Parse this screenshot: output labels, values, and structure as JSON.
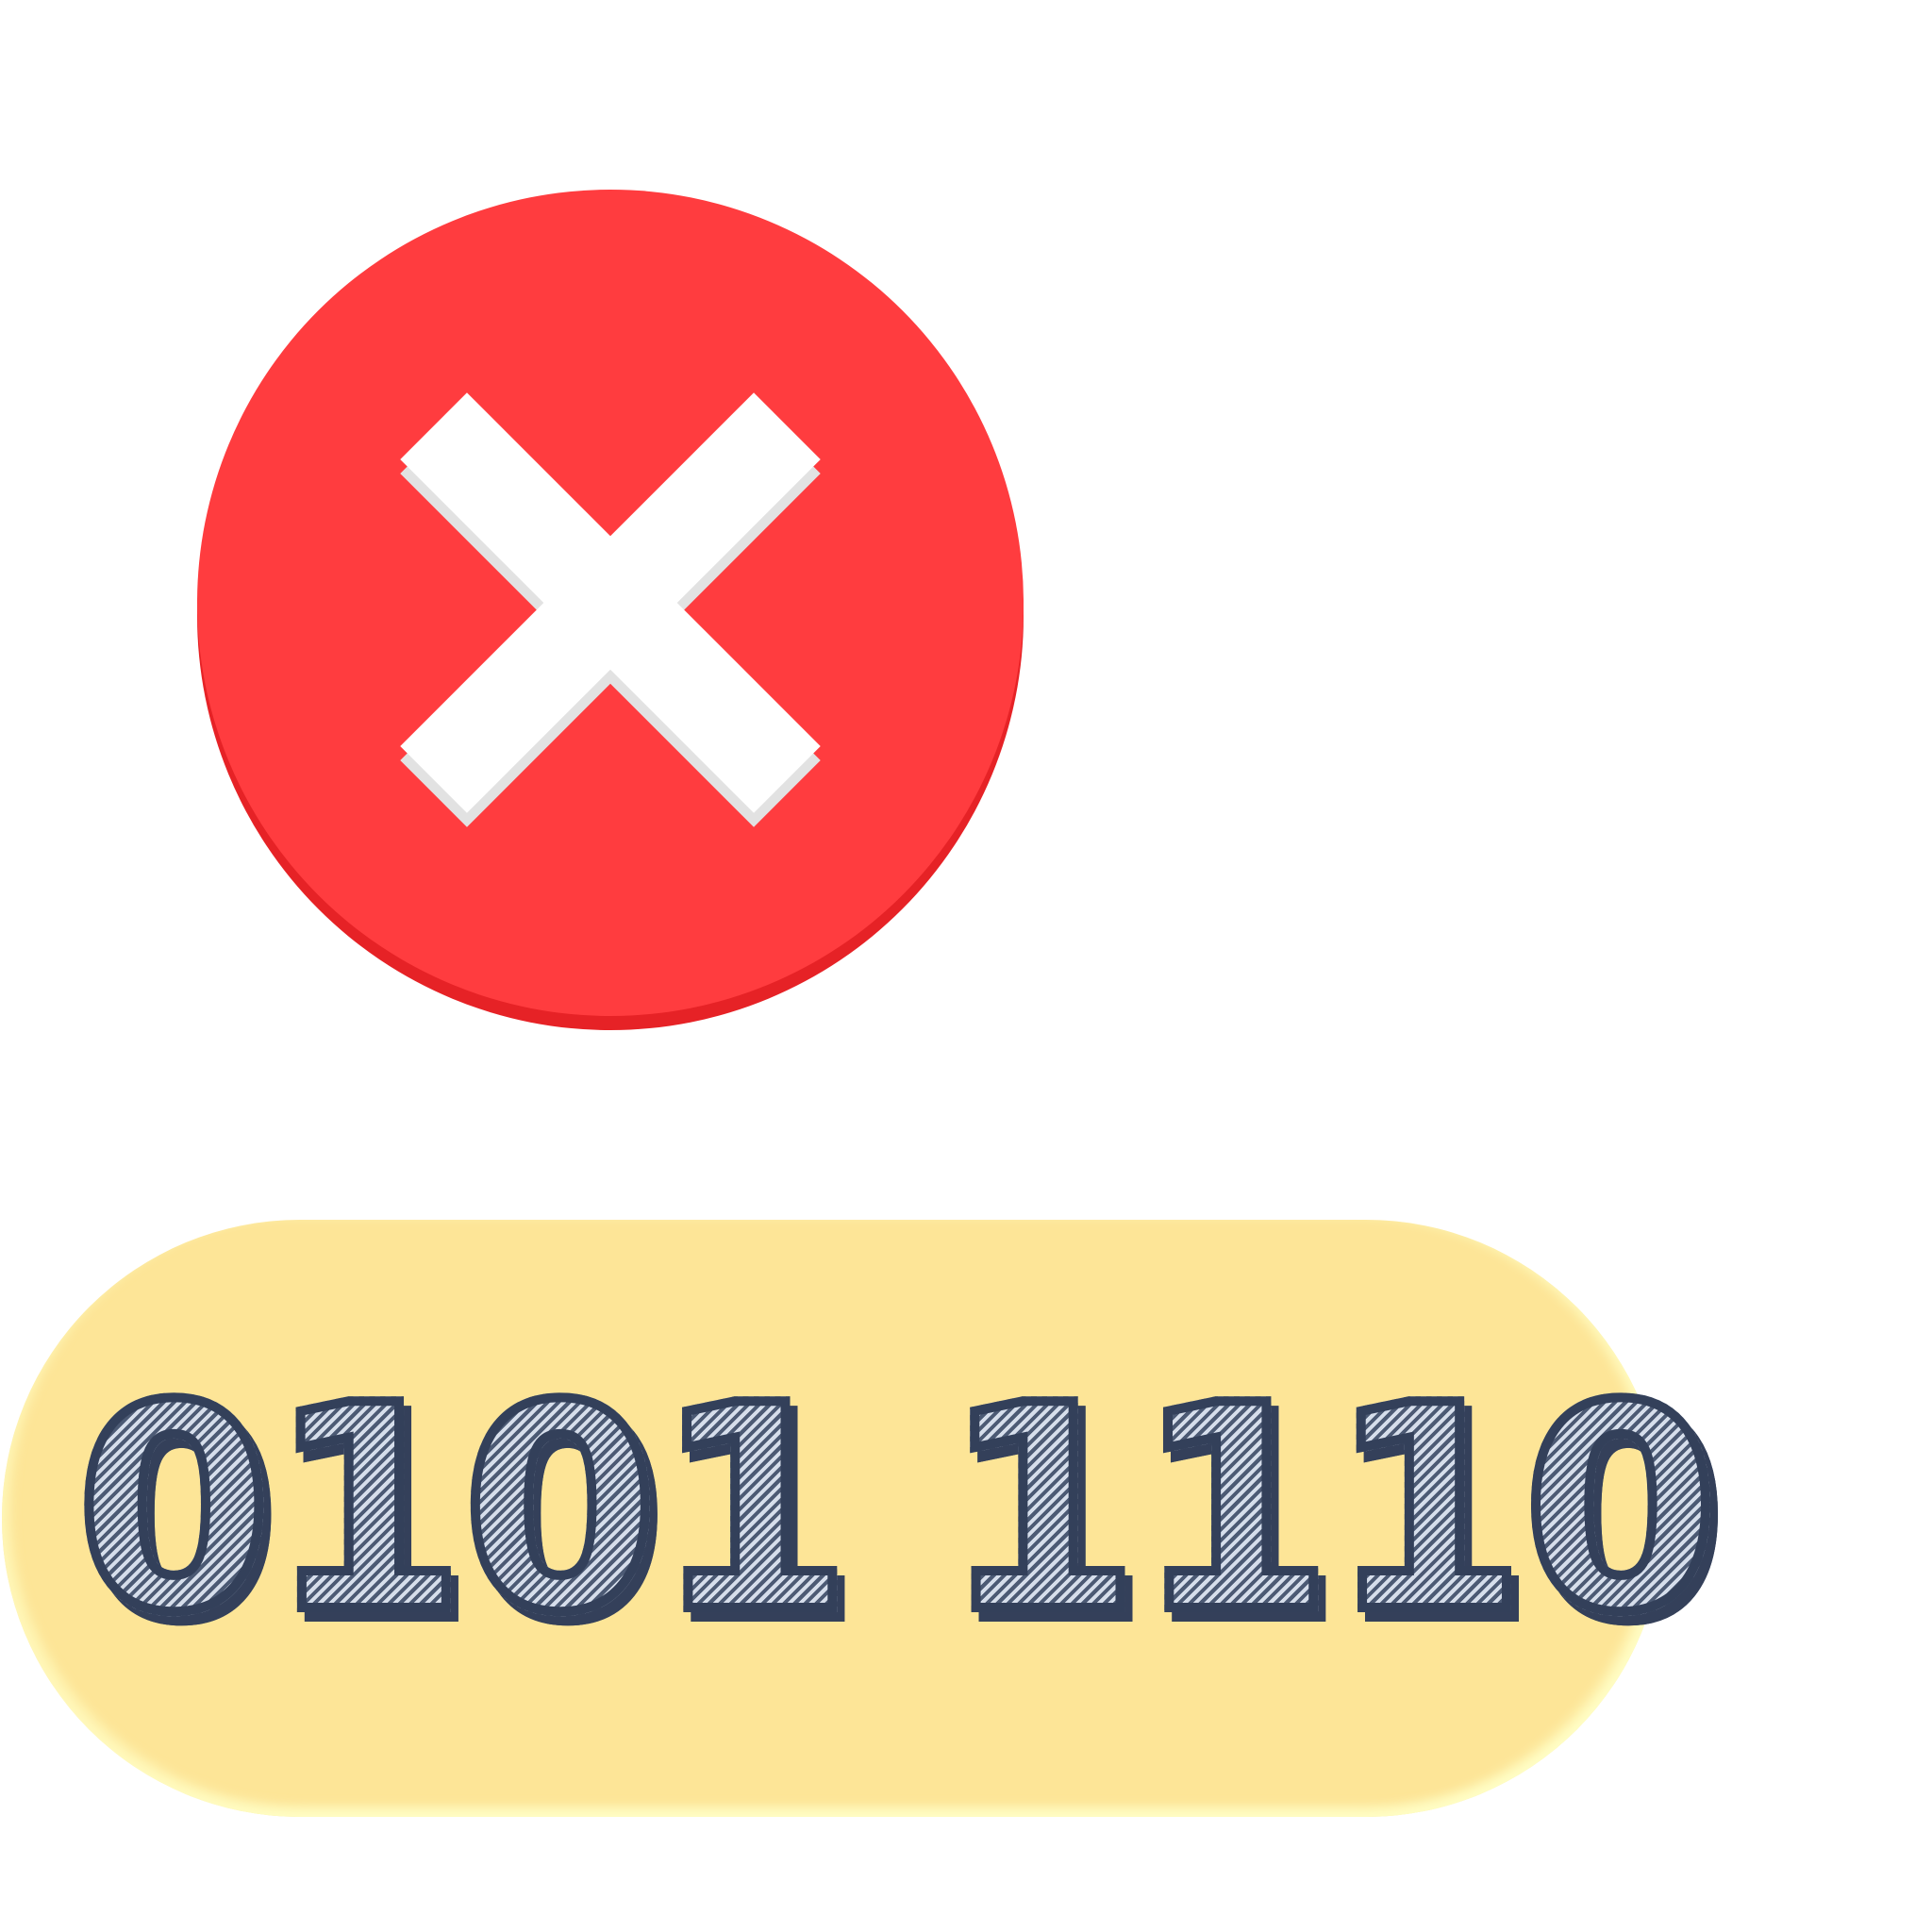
{
  "close_button": {
    "icon": "close-icon",
    "circle_color": "#ff3c3f",
    "circle_shadow_color": "#e62226",
    "cross_color": "#ffffff",
    "cross_shadow_color": "#e2e2e2"
  },
  "binary_display": {
    "text": "0101 1110",
    "background_color": "#fde597",
    "glyph_outline_color": "#33405a"
  }
}
